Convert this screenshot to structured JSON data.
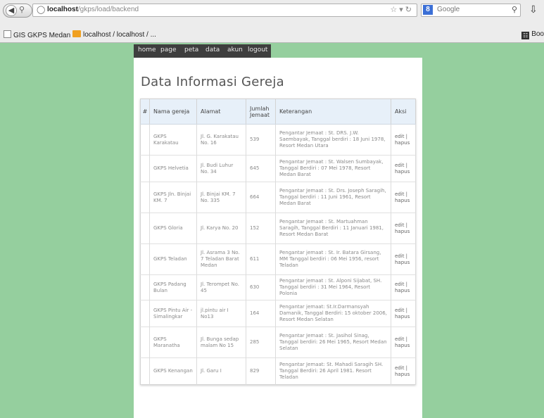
{
  "browser": {
    "url_host": "localhost",
    "url_path": "/gkps/load/backend",
    "search_placeholder": "Google",
    "bookmarks": [
      {
        "label": "GIS GKPS Medan ::"
      },
      {
        "label": "localhost / localhost / ..."
      }
    ],
    "bookmarks_right": "Boo"
  },
  "menu": {
    "items": [
      "home",
      "page",
      "peta",
      "data",
      "akun",
      "logout"
    ]
  },
  "page": {
    "title": "Data Informasi Gereja"
  },
  "table": {
    "headers": {
      "num": "#",
      "nama": "Nama gereja",
      "alamat": "Alamat",
      "jumlah": "Jumlah Jemaat",
      "keterangan": "Keterangan",
      "aksi": "Aksi"
    },
    "rows": [
      {
        "nama": "GKPS Karakatau",
        "alamat": "Jl. G. Karakatau No. 16",
        "jumlah": "539",
        "keterangan": "Pengantar Jemaat : St. DRS. J.W. Saembayak, Tanggal berdiri : 18 Juni 1978, Resort Medan Utara",
        "aksi": "edit | hapus"
      },
      {
        "nama": "GKPS Helvetia",
        "alamat": "Jl. Budi Luhur No. 34",
        "jumlah": "645",
        "keterangan": "Pengantar Jemaat : St. Walsen Sumbayak, Tanggal Berdiri : 07 Mei 1978, Resort Medan Barat",
        "aksi": "edit | hapus"
      },
      {
        "nama": "GKPS Jln. Binjai KM. 7",
        "alamat": "Jl. Binjai KM. 7 No. 335",
        "jumlah": "664",
        "keterangan": "Pengantar Jemaat : St. Drs. Joseph Saragih, Tanggal berdiri : 11 Juni 1961, Resort Medan Barat",
        "aksi": "edit | hapus"
      },
      {
        "nama": "GKPS Gloria",
        "alamat": "Jl. Karya No. 20",
        "jumlah": "152",
        "keterangan": "Pengantar Jemaat : St. Martuahman Saragih, Tanggal Berdiri : 11 Januari 1981, Resort Medan Barat",
        "aksi": "edit | hapus"
      },
      {
        "nama": "GKPS Teladan",
        "alamat": "Jl. Asrama 3 No. 7 Teladan Barat Medan",
        "jumlah": "611",
        "keterangan": "Pengantar jemaat : St. Ir. Batara Girsang, MM Tanggal berdiri : 06 Mei 1956, resort Teladan",
        "aksi": "edit | hapus"
      },
      {
        "nama": "GKPS Padang Bulan",
        "alamat": "Jl. Terompet No. 45",
        "jumlah": "630",
        "keterangan": "Pengantar jemaat : St. Alponi Sijabat, SH. Tanggal berdiri : 31 Mei 1964, Resort Polonia",
        "aksi": "edit | hapus"
      },
      {
        "nama": "GKPS Pintu Air - Simalingkar",
        "alamat": "jl.pintu air I No13",
        "jumlah": "164",
        "keterangan": "Pengantar jemaat: St.Ir.Darmansyah Damanik, Tanggal Berdiri: 15 oktober 2006, Resort Medan Selatan",
        "aksi": "edit | hapus"
      },
      {
        "nama": "GKPS Maranatha",
        "alamat": "Jl. Bunga sedap malam No 15",
        "jumlah": "285",
        "keterangan": "Pengantar Jemaat : St. Jasihol Sinag, Tanggal berdiri: 26 Mei 1965, Resort Medan Selatan",
        "aksi": "edit | hapus"
      },
      {
        "nama": "GKPS Kenangan",
        "alamat": "Jl. Garu I",
        "jumlah": "829",
        "keterangan": "Pengantar Jemaat: St. Mahadi Saragih SH. Tanggal Berdiri: 26 April 1981. Resort Teladan",
        "aksi": "edit | hapus"
      }
    ]
  }
}
